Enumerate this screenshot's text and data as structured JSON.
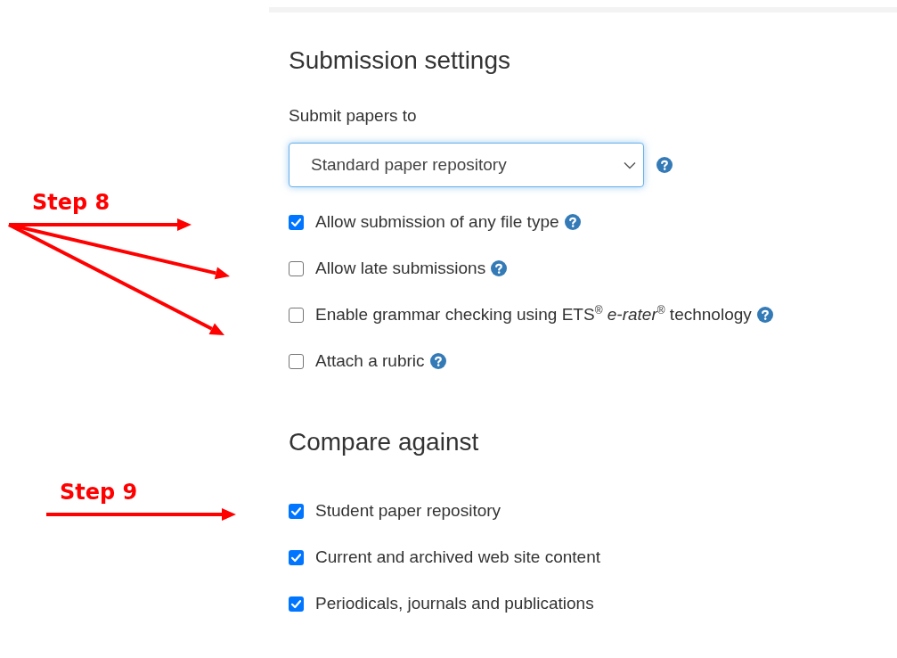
{
  "annotations": [
    {
      "label": "Step 8"
    },
    {
      "label": "Step 9"
    }
  ],
  "submission_settings": {
    "title": "Submission settings",
    "submit_label": "Submit papers to",
    "repository_select": {
      "value": "Standard paper repository"
    },
    "options": [
      {
        "label": "Allow submission of any file type",
        "checked": true,
        "help": true
      },
      {
        "label": "Allow late submissions",
        "checked": false,
        "help": true
      },
      {
        "label": "Enable grammar checking using ETS$^{®}$ *e-rater*$^{®}$ technology",
        "checked": false,
        "help": true
      },
      {
        "label": "Attach a rubric",
        "checked": false,
        "help": true
      }
    ]
  },
  "compare_against": {
    "title": "Compare against",
    "options": [
      {
        "label": "Student paper repository",
        "checked": true,
        "help": false
      },
      {
        "label": "Current and archived web site content",
        "checked": true,
        "help": false
      },
      {
        "label": "Periodicals, journals and publications",
        "checked": true,
        "help": false
      }
    ]
  }
}
